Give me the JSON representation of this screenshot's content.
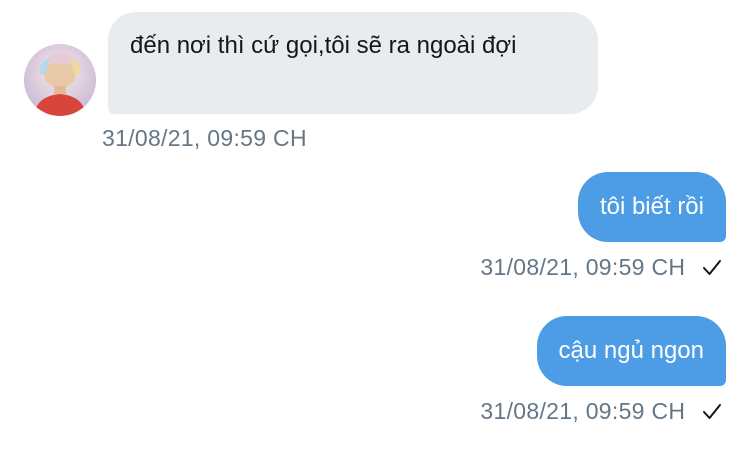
{
  "conversation": {
    "messages": [
      {
        "direction": "incoming",
        "text": "đến nơi thì cứ gọi,tôi sẽ ra ngoài đợi",
        "timestamp": "31/08/21, 09:59 CH"
      },
      {
        "direction": "outgoing",
        "text": "tôi biết rồi",
        "timestamp": "31/08/21, 09:59 CH",
        "status_icon": "checkmark-icon"
      },
      {
        "direction": "outgoing",
        "text": "cậu ngủ ngon",
        "timestamp": "31/08/21, 09:59 CH",
        "status_icon": "checkmark-icon"
      }
    ]
  },
  "colors": {
    "incoming_bubble": "#e8ecef",
    "outgoing_bubble": "#4c9de6",
    "timestamp_text": "#657786"
  }
}
